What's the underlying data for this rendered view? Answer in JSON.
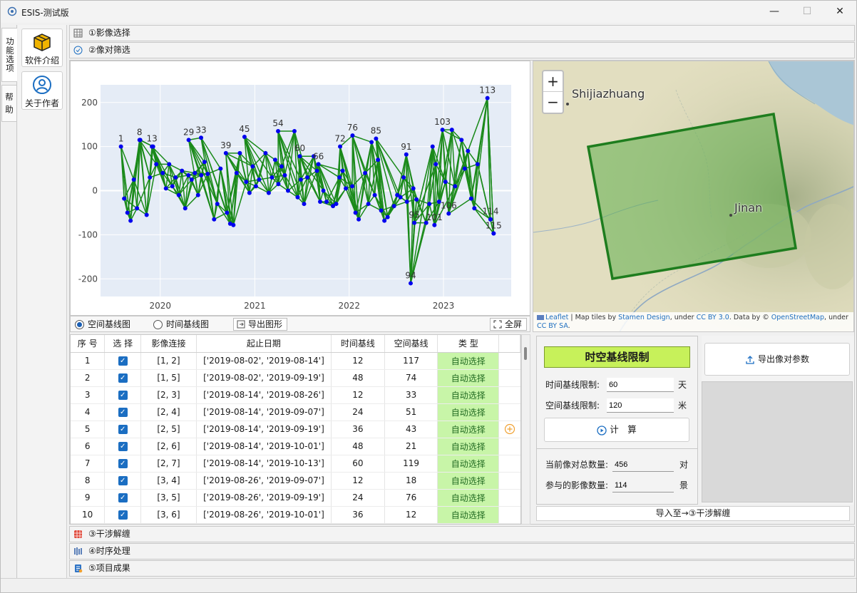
{
  "window": {
    "title": "ESIS-测试版",
    "minimize": "—",
    "maximize": "☐",
    "close": "✕"
  },
  "vertical_tabs": [
    "功能选项",
    "帮 助"
  ],
  "tools": [
    {
      "label": "软件介绍",
      "icon": "box-icon"
    },
    {
      "label": "关于作者",
      "icon": "person-icon"
    }
  ],
  "sections": {
    "s1": "①影像选择",
    "s2": "②像对筛选",
    "s3": "③干涉解缠",
    "s4": "④时序处理",
    "s5": "⑤项目成果"
  },
  "chart_controls": {
    "radio_spatial": "空间基线图",
    "radio_temporal": "时间基线图",
    "export": "导出图形",
    "fullscreen": "全屏"
  },
  "chart_data": {
    "type": "scatter",
    "title": "",
    "xlabel": "",
    "ylabel": "",
    "xlim": [
      "2019-05-15",
      "2023-09-20"
    ],
    "ylim": [
      -240,
      240
    ],
    "x_ticks": [
      "2020",
      "2021",
      "2022",
      "2023"
    ],
    "y_ticks": [
      200,
      100,
      0,
      -100,
      -200
    ],
    "grid": true,
    "node_color": "#0000ee",
    "edge_color": "#1a8a1a",
    "labeled_points": [
      {
        "id": 1,
        "date": "2019-08-02",
        "b": 100
      },
      {
        "id": 8,
        "date": "2019-10-13",
        "b": 115
      },
      {
        "id": 13,
        "date": "2019-11-30",
        "b": 100
      },
      {
        "id": 29,
        "date": "2020-04-20",
        "b": 115
      },
      {
        "id": 33,
        "date": "2020-06-07",
        "b": 120
      },
      {
        "id": 39,
        "date": "2020-09-11",
        "b": 85
      },
      {
        "id": 45,
        "date": "2020-11-22",
        "b": 122
      },
      {
        "id": 54,
        "date": "2021-04-01",
        "b": 135
      },
      {
        "id": 60,
        "date": "2021-06-24",
        "b": 78
      },
      {
        "id": 66,
        "date": "2021-09-04",
        "b": 60
      },
      {
        "id": 72,
        "date": "2021-11-27",
        "b": 100
      },
      {
        "id": 76,
        "date": "2022-01-14",
        "b": 125
      },
      {
        "id": 85,
        "date": "2022-04-15",
        "b": 118
      },
      {
        "id": 91,
        "date": "2022-08-10",
        "b": 82
      },
      {
        "id": 94,
        "date": "2022-08-27",
        "b": -210
      },
      {
        "id": 95,
        "date": "2022-09-10",
        "b": -73
      },
      {
        "id": 101,
        "date": "2022-11-27",
        "b": -78
      },
      {
        "id": 103,
        "date": "2022-12-28",
        "b": 138
      },
      {
        "id": 106,
        "date": "2023-01-21",
        "b": -52
      },
      {
        "id": 113,
        "date": "2023-06-20",
        "b": 210
      },
      {
        "id": 114,
        "date": "2023-07-02",
        "b": -65
      },
      {
        "id": 115,
        "date": "2023-07-14",
        "b": -97
      }
    ],
    "series": [
      {
        "b_values": [
          100,
          -18,
          -50,
          -68,
          25,
          -40,
          115,
          -8,
          -55,
          30,
          100,
          60,
          100,
          40,
          5,
          60,
          10,
          30,
          -10,
          45,
          -40,
          35,
          25,
          40,
          -10,
          35,
          65,
          38,
          115,
          -65,
          -30,
          50,
          120,
          -50,
          -75,
          -78,
          40,
          85,
          85,
          20,
          -5,
          55,
          10,
          25,
          122,
          85,
          -5,
          30,
          70,
          15,
          55,
          35,
          0,
          20,
          135,
          -15,
          25,
          -30,
          30,
          -10,
          78,
          45,
          -25,
          0,
          -25,
          60,
          -35,
          -30,
          30,
          45,
          5,
          100,
          10,
          -50,
          -65,
          125,
          40,
          -30,
          110,
          -10,
          70,
          -45,
          -68,
          -60,
          118,
          -35,
          -10,
          -15,
          30,
          -25,
          82,
          5,
          -20,
          -73,
          -210,
          -73,
          -30,
          100,
          60,
          -25,
          -78,
          20,
          25,
          138,
          10,
          -52,
          115,
          50,
          90,
          -18,
          -40,
          60,
          -60,
          25,
          210,
          -65,
          -97
        ]
      }
    ]
  },
  "table": {
    "columns": [
      "序 号",
      "选 择",
      "影像连接",
      "起止日期",
      "时间基线",
      "空间基线",
      "类 型"
    ],
    "rows": [
      {
        "no": "1",
        "pair": "[1, 2]",
        "dates": "['2019-08-02', '2019-08-14']",
        "t": "12",
        "s": "117",
        "type": "自动选择"
      },
      {
        "no": "2",
        "pair": "[1, 5]",
        "dates": "['2019-08-02', '2019-09-19']",
        "t": "48",
        "s": "74",
        "type": "自动选择"
      },
      {
        "no": "3",
        "pair": "[2, 3]",
        "dates": "['2019-08-14', '2019-08-26']",
        "t": "12",
        "s": "33",
        "type": "自动选择"
      },
      {
        "no": "4",
        "pair": "[2, 4]",
        "dates": "['2019-08-14', '2019-09-07']",
        "t": "24",
        "s": "51",
        "type": "自动选择"
      },
      {
        "no": "5",
        "pair": "[2, 5]",
        "dates": "['2019-08-14', '2019-09-19']",
        "t": "36",
        "s": "43",
        "type": "自动选择"
      },
      {
        "no": "6",
        "pair": "[2, 6]",
        "dates": "['2019-08-14', '2019-10-01']",
        "t": "48",
        "s": "21",
        "type": "自动选择"
      },
      {
        "no": "7",
        "pair": "[2, 7]",
        "dates": "['2019-08-14', '2019-10-13']",
        "t": "60",
        "s": "119",
        "type": "自动选择"
      },
      {
        "no": "8",
        "pair": "[3, 4]",
        "dates": "['2019-08-26', '2019-09-07']",
        "t": "12",
        "s": "18",
        "type": "自动选择"
      },
      {
        "no": "9",
        "pair": "[3, 5]",
        "dates": "['2019-08-26', '2019-09-19']",
        "t": "24",
        "s": "76",
        "type": "自动选择"
      },
      {
        "no": "10",
        "pair": "[3, 6]",
        "dates": "['2019-08-26', '2019-10-01']",
        "t": "36",
        "s": "12",
        "type": "自动选择"
      }
    ]
  },
  "map": {
    "city1": "Shijiazhuang",
    "city2": "Jinan",
    "zoom_in": "+",
    "zoom_out": "−",
    "attribution": {
      "leaflet": "Leaflet",
      "t1": " | Map tiles by ",
      "stamen": "Stamen Design",
      "t2": ", under ",
      "cc": "CC BY 3.0",
      "t3": ". Data by © ",
      "osm": "OpenStreetMap",
      "t4": ", under ",
      "ccsa": "CC BY SA",
      "t5": "."
    },
    "footprint_color": "#1e7d1e"
  },
  "params": {
    "headline": "时空基线限制",
    "time_label": "时间基线限制:",
    "time_value": "60",
    "time_unit": "天",
    "space_label": "空间基线限制:",
    "space_value": "120",
    "space_unit": "米",
    "calc": "计　算",
    "total_label": "当前像对总数量:",
    "total_value": "456",
    "total_unit": "对",
    "images_label": "参与的影像数量:",
    "images_value": "114",
    "images_unit": "景",
    "export_params": "导出像对参数",
    "import": "导入至→③干涉解缠"
  }
}
